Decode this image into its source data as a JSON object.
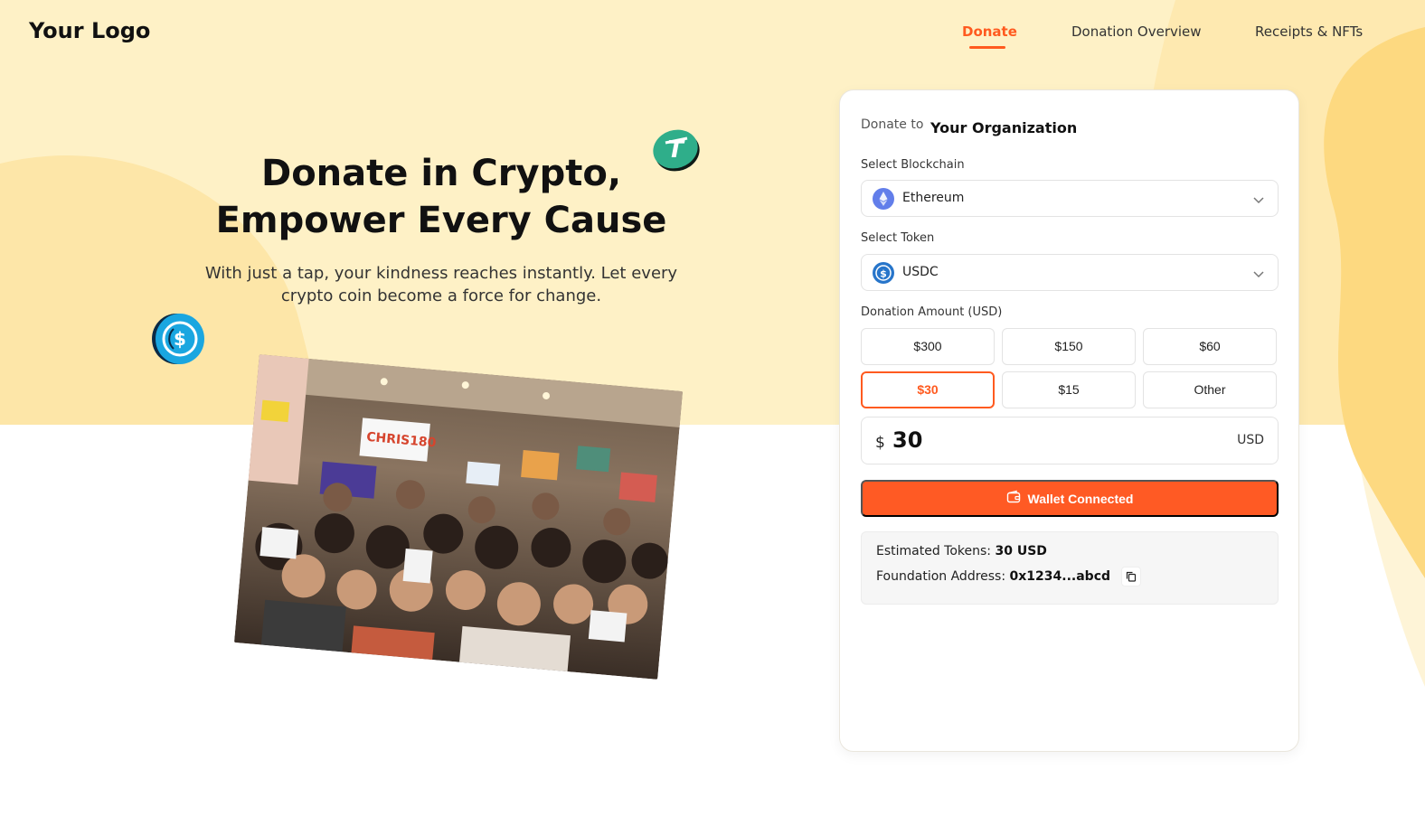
{
  "brand": {
    "logo": "Your Logo",
    "accent": "#FF5A1F",
    "hero_bg": "#FEF1C6"
  },
  "nav": [
    {
      "label": "Donate",
      "active": true
    },
    {
      "label": "Donation Overview",
      "active": false
    },
    {
      "label": "Receipts & NFTs",
      "active": false
    }
  ],
  "hero": {
    "title_line1": "Donate in Crypto,",
    "title_line2": "Empower Every Cause",
    "subtitle_line1": "With just a tap, your kindness reaches instantly. Let every",
    "subtitle_line2": "crypto coin become a force for change."
  },
  "card": {
    "donate_to": "Donate to",
    "organization": "Your Organization",
    "blockchain_label": "Select Blockchain",
    "blockchain_value": "Ethereum",
    "token_label": "Select Token",
    "token_value": "USDC",
    "amount_label": "Donation Amount (USD)",
    "amount_options": [
      "$300",
      "$150",
      "$60",
      "$30",
      "$15",
      "Other"
    ],
    "selected_option": "$30",
    "currency_symbol": "$",
    "amount_value": "30",
    "currency": "USD",
    "wallet_button": "Wallet Connected",
    "estimated_label": "Estimated Tokens:",
    "estimated_value": "30 USD",
    "address_label": "Foundation Address:",
    "address_value": "0x1234...abcd"
  }
}
